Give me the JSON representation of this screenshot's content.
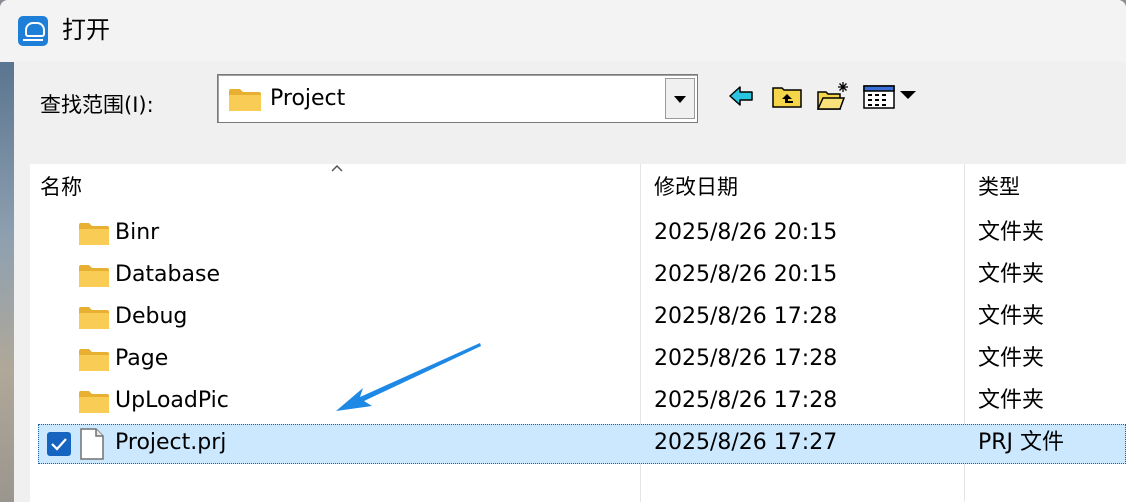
{
  "window": {
    "title": "打开"
  },
  "lookin": {
    "label": "查找范围(I):",
    "value": "Project"
  },
  "toolbar": {
    "icons": [
      "back-icon",
      "up-folder-icon",
      "new-folder-icon",
      "view-menu-icon"
    ]
  },
  "columns": {
    "name": "名称",
    "date": "修改日期",
    "type": "类型"
  },
  "files": [
    {
      "name": "Binr",
      "date": "2025/8/26 20:15",
      "type": "文件夹",
      "icon": "folder-icon"
    },
    {
      "name": "Database",
      "date": "2025/8/26 20:15",
      "type": "文件夹",
      "icon": "folder-icon"
    },
    {
      "name": "Debug",
      "date": "2025/8/26 17:28",
      "type": "文件夹",
      "icon": "folder-icon"
    },
    {
      "name": "Page",
      "date": "2025/8/26 17:28",
      "type": "文件夹",
      "icon": "folder-icon"
    },
    {
      "name": "UpLoadPic",
      "date": "2025/8/26 17:28",
      "type": "文件夹",
      "icon": "folder-icon"
    },
    {
      "name": "Project.prj",
      "date": "2025/8/26 17:27",
      "type": "PRJ 文件",
      "icon": "file-icon",
      "selected": true
    }
  ],
  "colors": {
    "selection": "#cce8ff",
    "folder": "#f5c242",
    "annotation_arrow": "#1e88e5"
  }
}
